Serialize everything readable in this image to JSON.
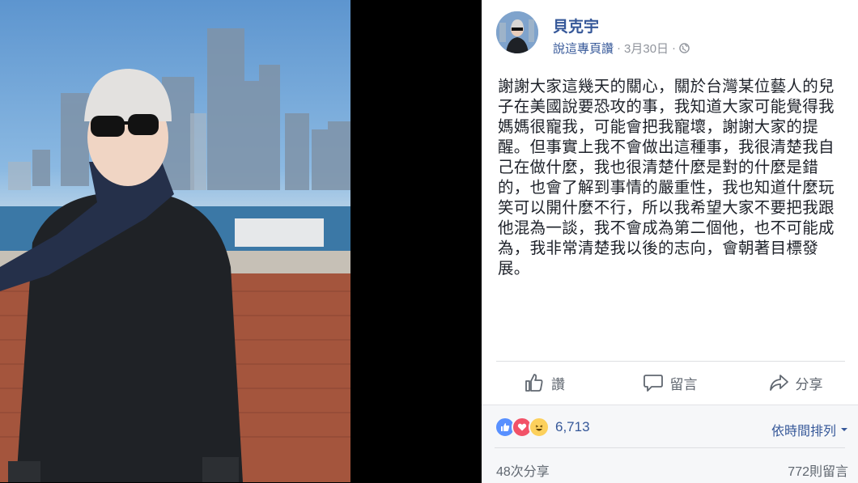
{
  "post": {
    "author": "貝克宇",
    "via": "說這專頁讚",
    "date": "3月30日",
    "dot": "·",
    "dot2": "·",
    "text": "謝謝大家這幾天的關心，關於台灣某位藝人的兒子在美國說要恐攻的事，我知道大家可能覺得我媽媽很寵我，可能會把我寵壞，謝謝大家的提醒。但事實上我不會做出這種事，我很清楚我自己在做什麼，我也很清楚什麼是對的什麼是錯的，也會了解到事情的嚴重性，我也知道什麼玩笑可以開什麼不行，所以我希望大家不要把我跟他混為一談，我不會成為第二個他，也不可能成為，我非常清楚我以後的志向，會朝著目標發展。"
  },
  "actions": {
    "like": "讚",
    "comment": "留言",
    "share": "分享"
  },
  "footer": {
    "reaction_count": "6,713",
    "sort_label": "依時間排列",
    "shares": "48次分享",
    "comments": "772則留言"
  },
  "colors": {
    "link": "#365899",
    "like_blue": "#5890ff",
    "love_red": "#f25268",
    "haha_yellow": "#fcd05c"
  },
  "icons": [
    "globe-icon",
    "like-icon",
    "comment-icon",
    "share-icon",
    "like-reaction-icon",
    "love-reaction-icon",
    "haha-reaction-icon",
    "caret-down-icon"
  ]
}
